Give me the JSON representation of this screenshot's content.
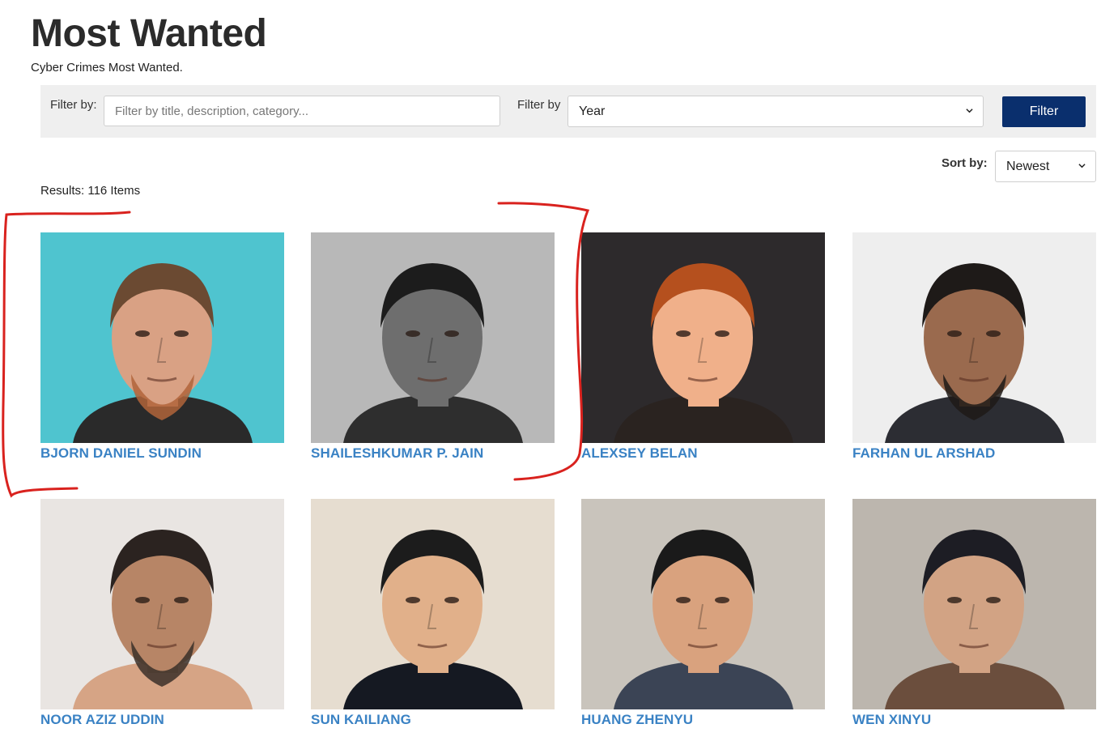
{
  "header": {
    "title": "Most Wanted",
    "subtitle": "Cyber Crimes Most Wanted."
  },
  "filters": {
    "text_label": "Filter by:",
    "text_placeholder": "Filter by title, description, category...",
    "text_value": "",
    "select_label": "Filter by",
    "select_value": "Year",
    "button_label": "Filter"
  },
  "sort": {
    "label": "Sort by:",
    "value": "Newest"
  },
  "results_text": "Results: 116 Items",
  "people": [
    {
      "name": "BJORN DANIEL SUNDIN",
      "bg": "#4fc4cf",
      "skin": "#d9a184",
      "hair": "#6b4a32",
      "shirt": "#2a2a2a",
      "beard": "#b0643a"
    },
    {
      "name": "SHAILESHKUMAR P. JAIN",
      "bg": "#b8b8b8",
      "skin": "#6e6e6e",
      "hair": "#1c1c1c",
      "shirt": "#2e2e2e",
      "beard": ""
    },
    {
      "name": "ALEXSEY BELAN",
      "bg": "#2d2a2c",
      "skin": "#f0b08a",
      "hair": "#b5501e",
      "shirt": "#2a2320",
      "beard": ""
    },
    {
      "name": "FARHAN UL ARSHAD",
      "bg": "#eeeeee",
      "skin": "#9a6a4e",
      "hair": "#1e1a18",
      "shirt": "#2c2d33",
      "beard": "#1e1a18"
    },
    {
      "name": "NOOR AZIZ UDDIN",
      "bg": "#e9e5e2",
      "skin": "#b78566",
      "hair": "#2b2320",
      "shirt": "#d6a485",
      "beard": "#3b3029"
    },
    {
      "name": "SUN KAILIANG",
      "bg": "#e6ddd0",
      "skin": "#e1b08a",
      "hair": "#1c1c1c",
      "shirt": "#151922",
      "beard": ""
    },
    {
      "name": "HUANG ZHENYU",
      "bg": "#c9c4bc",
      "skin": "#d9a27e",
      "hair": "#1a1a1a",
      "shirt": "#3b4455",
      "beard": ""
    },
    {
      "name": "WEN XINYU",
      "bg": "#bcb6ae",
      "skin": "#d2a384",
      "hair": "#1d1d24",
      "shirt": "#6b4e3d",
      "beard": ""
    }
  ],
  "icons": {
    "chevron": "chevron-down-icon"
  }
}
